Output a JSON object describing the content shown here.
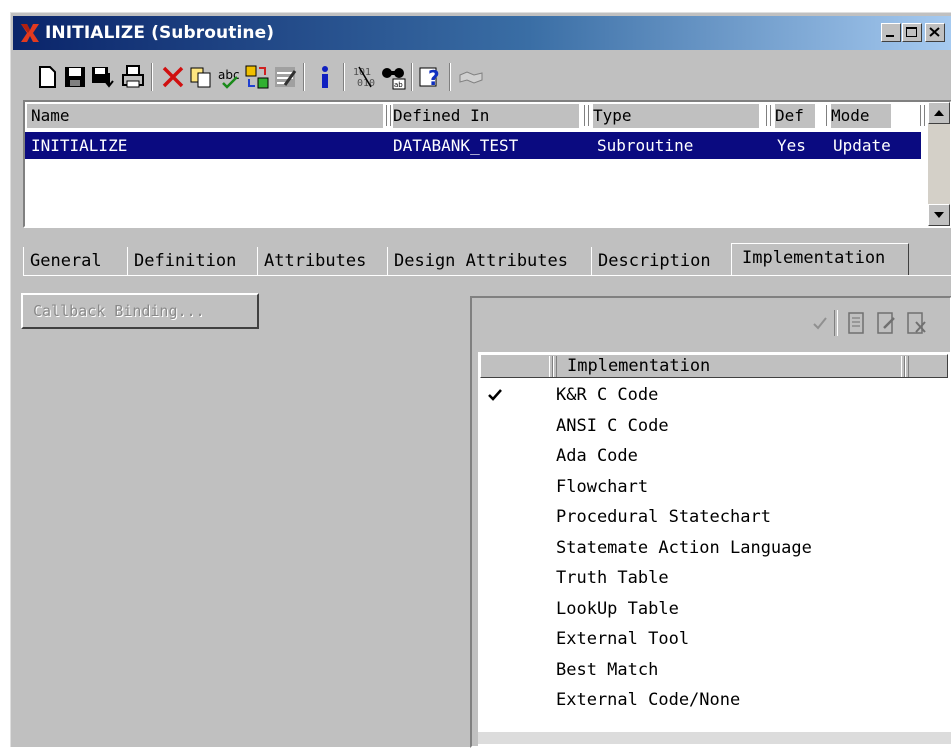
{
  "window": {
    "title": "INITIALIZE (Subroutine)",
    "icon": "x-logo-icon",
    "controls": [
      "minimize",
      "maximize",
      "close"
    ]
  },
  "toolbar": {
    "buttons": [
      "new-icon",
      "save-icon",
      "save-down-icon",
      "print-icon",
      "delete-icon",
      "copy-icon",
      "spell-icon",
      "refresh-icon",
      "clear-icon",
      "info-icon",
      "search-icon",
      "binoculars-icon",
      "help-icon",
      "handshake-icon"
    ]
  },
  "grid": {
    "columns": [
      "Name",
      "Defined In",
      "Type",
      "Def",
      "Mode"
    ],
    "rows": [
      {
        "name": "INITIALIZE",
        "defined_in": "DATABANK_TEST",
        "type": "Subroutine",
        "def": "Yes",
        "mode": "Update"
      }
    ]
  },
  "tabs": [
    {
      "label": "General",
      "active": false
    },
    {
      "label": "Definition",
      "active": false
    },
    {
      "label": "Attributes",
      "active": false
    },
    {
      "label": "Design Attributes",
      "active": false
    },
    {
      "label": "Description",
      "active": false
    },
    {
      "label": "Implementation",
      "active": true
    }
  ],
  "implementation_tab": {
    "callback_button": "Callback Binding...",
    "list_header": "Implementation",
    "items": [
      {
        "label": "K&R C Code",
        "checked": true
      },
      {
        "label": "ANSI C Code",
        "checked": false
      },
      {
        "label": "Ada Code",
        "checked": false
      },
      {
        "label": "Flowchart",
        "checked": false
      },
      {
        "label": "Procedural Statechart",
        "checked": false
      },
      {
        "label": "Statemate Action Language",
        "checked": false
      },
      {
        "label": "Truth Table",
        "checked": false
      },
      {
        "label": "LookUp Table",
        "checked": false
      },
      {
        "label": "External Tool",
        "checked": false
      },
      {
        "label": "Best Match",
        "checked": false
      },
      {
        "label": "External Code/None",
        "checked": false
      }
    ]
  },
  "colors": {
    "title_start": "#0a246a",
    "title_end": "#a6caf0",
    "selection": "#0a0a80",
    "face": "#c0c0c0"
  }
}
